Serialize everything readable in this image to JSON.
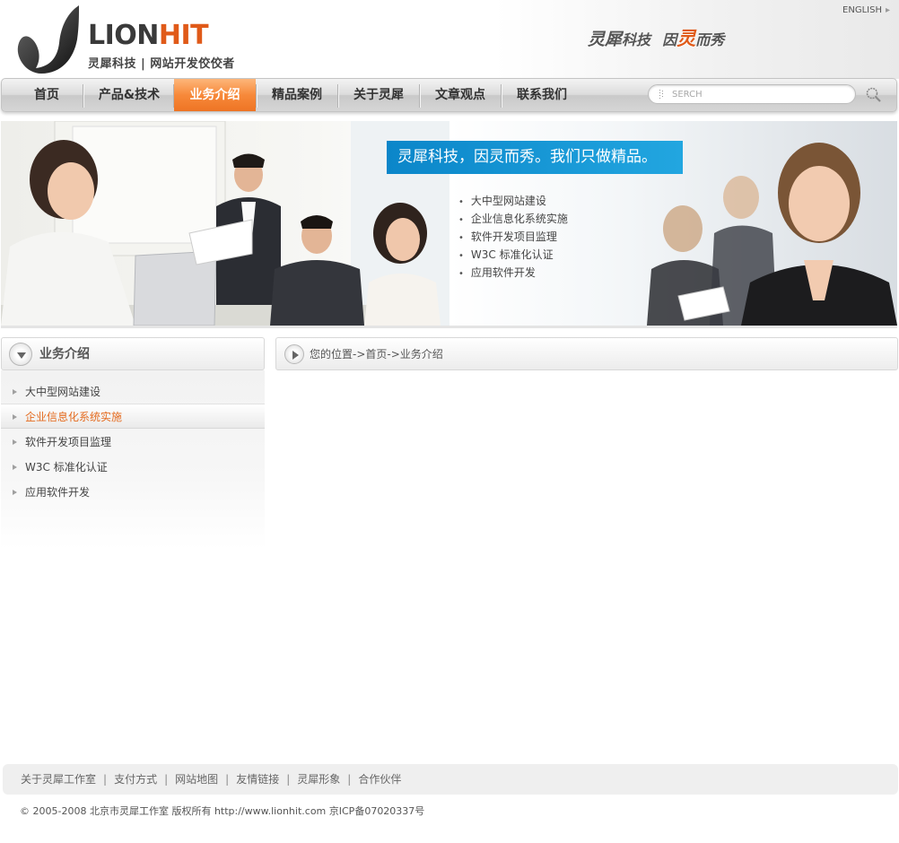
{
  "header": {
    "logo_word_1": "LION",
    "logo_word_2": "HIT",
    "tagline": "灵犀科技 | 网站开发佼佼者",
    "english_link": "ENGLISH",
    "slogan_part1": "灵犀",
    "slogan_part2": "科技",
    "slogan_part3": "因",
    "slogan_accent": "灵",
    "slogan_part4": "而秀"
  },
  "nav": {
    "items": [
      {
        "label": "首页"
      },
      {
        "label": "产品&技术"
      },
      {
        "label": "业务介绍"
      },
      {
        "label": "精品案例"
      },
      {
        "label": "关于灵犀"
      },
      {
        "label": "文章观点"
      },
      {
        "label": "联系我们"
      }
    ],
    "active_label": "业务介绍",
    "search_placeholder": "SERCH"
  },
  "banner": {
    "headline": "灵犀科技，因灵而秀。我们只做精品。",
    "services": [
      "大中型网站建设",
      "企业信息化系统实施",
      "软件开发项目监理",
      "W3C 标准化认证",
      "应用软件开发"
    ]
  },
  "sidebar": {
    "title": "业务介绍",
    "items": [
      {
        "label": "大中型网站建设"
      },
      {
        "label": "企业信息化系统实施"
      },
      {
        "label": "软件开发项目监理"
      },
      {
        "label": "W3C 标准化认证"
      },
      {
        "label": "应用软件开发"
      }
    ],
    "active_label": "企业信息化系统实施"
  },
  "breadcrumb": {
    "text": "您的位置->首页->业务介绍"
  },
  "footer": {
    "links": [
      "关于灵犀工作室",
      "支付方式",
      "网站地图",
      "友情链接",
      "灵犀形象",
      "合作伙伴"
    ],
    "separator": "|",
    "copyright": "© 2005-2008 北京市灵犀工作室 版权所有 http://www.lionhit.com 京ICP备07020337号"
  },
  "colors": {
    "accent_orange": "#ee7424",
    "banner_blue": "#0b86c9",
    "text_dark": "#333333"
  },
  "icons": {
    "logo": "swoosh-logo-icon",
    "search": "magnifier-icon",
    "header_circle": "chevron-down-circle-icon",
    "crumb_circle": "play-circle-icon",
    "list_bullet": "triangle-bullet-icon"
  }
}
